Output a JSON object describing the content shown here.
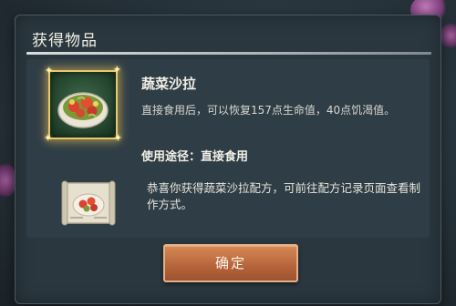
{
  "dialog": {
    "title": "获得物品",
    "item": {
      "name": "蔬菜沙拉",
      "icon": "vegetable-salad-icon",
      "description": "直接食用后，可以恢复157点生命值，40点饥渴值。",
      "usage": "使用途径：直接食用"
    },
    "recipe": {
      "icon": "recipe-scroll-icon",
      "message": "恭喜你获得蔬菜沙拉配方，可前往配方记录页面查看制作方式。"
    },
    "confirm_label": "确定"
  },
  "colors": {
    "panel": "#2a373f",
    "item_frame_border": "#e6c96a",
    "button": "#b8663b"
  }
}
